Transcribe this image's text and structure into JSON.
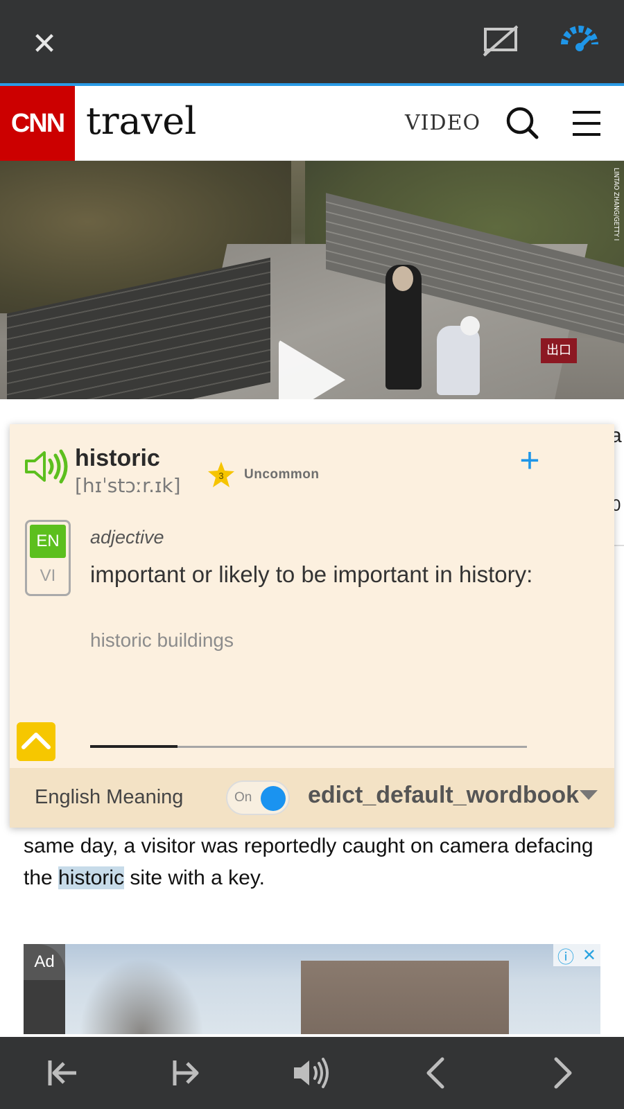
{
  "topbar": {
    "close_icon": "close-icon",
    "cast_icon": "cast-off-icon",
    "speed_icon": "gauge-icon",
    "accent_color": "#2a9be6"
  },
  "cnn": {
    "logo": "CNN",
    "section": "travel",
    "video_label": "VIDEO",
    "brand_color": "#cc0000"
  },
  "hero": {
    "sign_text": "出口",
    "credit": "LINTAO ZHANG/GETTY I"
  },
  "dictionary": {
    "word": "historic",
    "phonetic": "[hɪˈstɔːr.ɪk]",
    "frequency_level": "3",
    "frequency_label": "Uncommon",
    "add_label": "+",
    "languages": {
      "en": "EN",
      "vi": "VI"
    },
    "part_of_speech": "adjective",
    "definition": "important or likely to be important in history:",
    "example": "historic buildings",
    "progress": 0.2,
    "footer": {
      "label": "English Meaning",
      "toggle_text": "On",
      "wordbook": "edict_default_wordbook"
    }
  },
  "article": {
    "text_before": "same day, a visitor was reportedly caught on camera defacing the ",
    "highlighted": "historic",
    "text_after": " site with a key.",
    "side_fragment_a": "a",
    "side_fragment_0": "0"
  },
  "ad": {
    "label": "Ad",
    "info_icon": "ⓘ",
    "close_icon": "✕"
  },
  "bottombar": {
    "items": [
      "skip-back-icon",
      "skip-forward-icon",
      "speaker-icon",
      "prev-icon",
      "next-icon"
    ]
  }
}
